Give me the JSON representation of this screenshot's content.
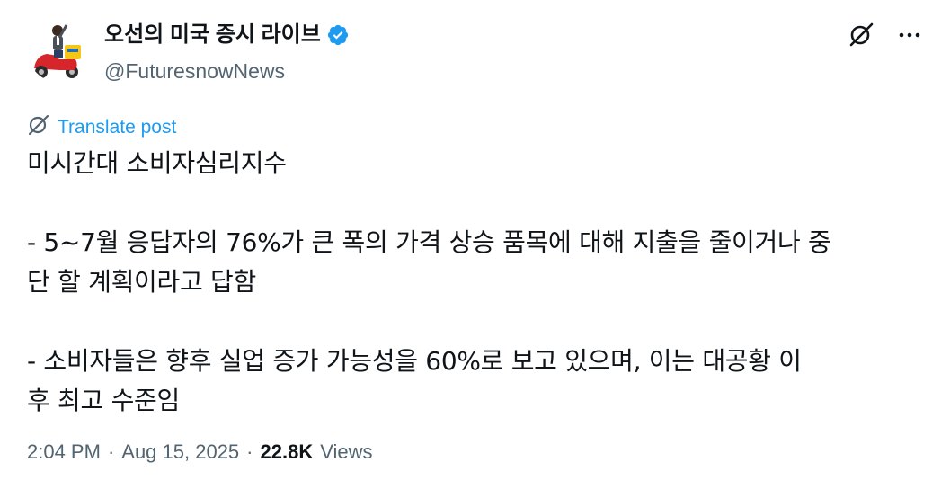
{
  "author": {
    "display_name": "오선의 미국 증시 라이브",
    "handle": "@FuturesnowNews",
    "verified_color": "#1d9bf0"
  },
  "translate": {
    "label": "Translate post"
  },
  "post": {
    "line1": "미시간대 소비자심리지수",
    "para2_line1": "- 5~7월 응답자의 76%가 큰 폭의 가격 상승 품목에 대해 지출을 줄이거나 중",
    "para2_line2": "단 할 계획이라고 답함",
    "para3_line1": "- 소비자들은 향후 실업 증가 가능성을 60%로 보고 있으며, 이는 대공황 이",
    "para3_line2": "후 최고 수준임"
  },
  "meta": {
    "time": "2:04 PM",
    "sep1": "·",
    "date": "Aug 15, 2025",
    "sep2": "·",
    "views_count": "22.8K",
    "views_label": "Views"
  },
  "icons": {
    "grok": "grok-icon",
    "more": "more-icon",
    "translate": "translate-icon",
    "verified": "verified-badge-icon"
  }
}
